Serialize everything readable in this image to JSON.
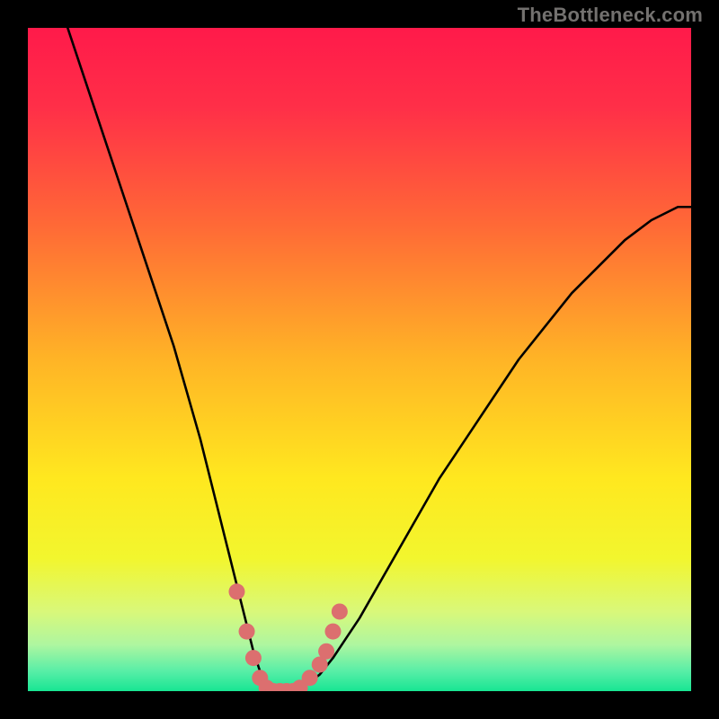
{
  "attribution": "TheBottleneck.com",
  "colors": {
    "gradient_stops": [
      {
        "offset": 0.0,
        "color": "#ff1a4a"
      },
      {
        "offset": 0.12,
        "color": "#ff2f48"
      },
      {
        "offset": 0.3,
        "color": "#ff6a36"
      },
      {
        "offset": 0.5,
        "color": "#ffb426"
      },
      {
        "offset": 0.68,
        "color": "#ffe81f"
      },
      {
        "offset": 0.8,
        "color": "#f2f62e"
      },
      {
        "offset": 0.88,
        "color": "#d9f87a"
      },
      {
        "offset": 0.93,
        "color": "#aef6a0"
      },
      {
        "offset": 0.97,
        "color": "#58eea7"
      },
      {
        "offset": 1.0,
        "color": "#18e593"
      }
    ],
    "curve": "#000000",
    "dots": "#dc6f6f"
  },
  "chart_data": {
    "type": "line",
    "title": "",
    "xlabel": "",
    "ylabel": "",
    "xlim": [
      0,
      100
    ],
    "ylim": [
      0,
      100
    ],
    "series": [
      {
        "name": "bottleneck-curve",
        "x": [
          6,
          8,
          10,
          12,
          14,
          16,
          18,
          20,
          22,
          24,
          26,
          28,
          30,
          31,
          32,
          33,
          34,
          35,
          36,
          37,
          38,
          39,
          40,
          42,
          44,
          46,
          48,
          50,
          54,
          58,
          62,
          66,
          70,
          74,
          78,
          82,
          86,
          90,
          94,
          98,
          100
        ],
        "y": [
          100,
          94,
          88,
          82,
          76,
          70,
          64,
          58,
          52,
          45,
          38,
          30,
          22,
          18,
          14,
          10,
          6,
          3,
          1,
          0,
          0,
          0,
          0,
          1,
          2.5,
          5,
          8,
          11,
          18,
          25,
          32,
          38,
          44,
          50,
          55,
          60,
          64,
          68,
          71,
          73,
          73
        ]
      }
    ],
    "dots": {
      "name": "highlight-points",
      "points": [
        {
          "x": 31.5,
          "y": 15
        },
        {
          "x": 33.0,
          "y": 9
        },
        {
          "x": 34.0,
          "y": 5
        },
        {
          "x": 35.0,
          "y": 2
        },
        {
          "x": 36.0,
          "y": 0.5
        },
        {
          "x": 37.0,
          "y": 0
        },
        {
          "x": 38.0,
          "y": 0
        },
        {
          "x": 39.0,
          "y": 0
        },
        {
          "x": 40.0,
          "y": 0
        },
        {
          "x": 41.0,
          "y": 0.5
        },
        {
          "x": 42.5,
          "y": 2
        },
        {
          "x": 44.0,
          "y": 4
        },
        {
          "x": 45.0,
          "y": 6
        },
        {
          "x": 46.0,
          "y": 9
        },
        {
          "x": 47.0,
          "y": 12
        }
      ]
    }
  }
}
